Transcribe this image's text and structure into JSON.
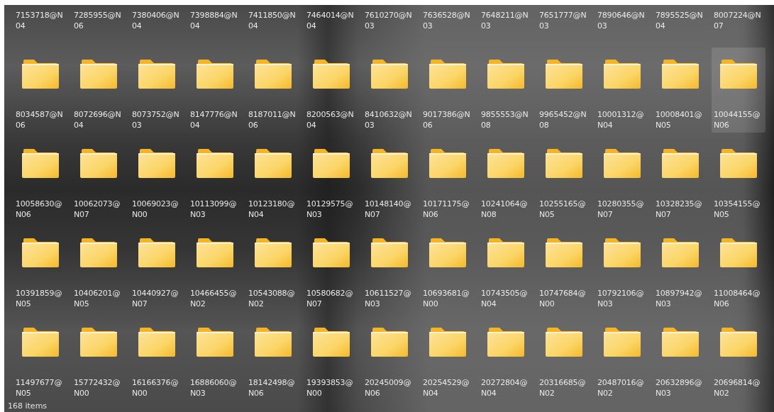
{
  "top_row_labels": [
    "7153718@N04",
    "7285955@N06",
    "7380406@N04",
    "7398884@N04",
    "7411850@N04",
    "7464014@N04",
    "7610270@N03",
    "7636528@N03",
    "7648211@N03",
    "7651777@N03",
    "7890646@N03",
    "7895525@N04",
    "8007224@N07"
  ],
  "items": [
    {
      "name": "8034587@N06",
      "selected": false
    },
    {
      "name": "8072696@N04",
      "selected": false
    },
    {
      "name": "8073752@N03",
      "selected": false
    },
    {
      "name": "8147776@N04",
      "selected": false
    },
    {
      "name": "8187011@N06",
      "selected": false
    },
    {
      "name": "8200563@N04",
      "selected": false
    },
    {
      "name": "8410632@N03",
      "selected": false
    },
    {
      "name": "9017386@N06",
      "selected": false
    },
    {
      "name": "9855553@N08",
      "selected": false
    },
    {
      "name": "9965452@N08",
      "selected": false
    },
    {
      "name": "10001312@N04",
      "selected": false
    },
    {
      "name": "10008401@N05",
      "selected": false
    },
    {
      "name": "10044155@N06",
      "selected": true
    },
    {
      "name": "10058630@N06",
      "selected": false
    },
    {
      "name": "10062073@N07",
      "selected": false
    },
    {
      "name": "10069023@N00",
      "selected": false
    },
    {
      "name": "10113099@N03",
      "selected": false
    },
    {
      "name": "10123180@N04",
      "selected": false
    },
    {
      "name": "10129575@N03",
      "selected": false
    },
    {
      "name": "10148140@N07",
      "selected": false
    },
    {
      "name": "10171175@N06",
      "selected": false
    },
    {
      "name": "10241064@N08",
      "selected": false
    },
    {
      "name": "10255165@N05",
      "selected": false
    },
    {
      "name": "10280355@N07",
      "selected": false
    },
    {
      "name": "10328235@N07",
      "selected": false
    },
    {
      "name": "10354155@N05",
      "selected": false
    },
    {
      "name": "10391859@N05",
      "selected": false
    },
    {
      "name": "10406201@N05",
      "selected": false
    },
    {
      "name": "10440927@N07",
      "selected": false
    },
    {
      "name": "10466455@N02",
      "selected": false
    },
    {
      "name": "10543088@N02",
      "selected": false
    },
    {
      "name": "10580682@N07",
      "selected": false
    },
    {
      "name": "10611527@N03",
      "selected": false
    },
    {
      "name": "10693681@N00",
      "selected": false
    },
    {
      "name": "10743505@N04",
      "selected": false
    },
    {
      "name": "10747684@N00",
      "selected": false
    },
    {
      "name": "10792106@N03",
      "selected": false
    },
    {
      "name": "10897942@N03",
      "selected": false
    },
    {
      "name": "11008464@N06",
      "selected": false
    },
    {
      "name": "11497677@N05",
      "selected": false
    },
    {
      "name": "15772432@N00",
      "selected": false
    },
    {
      "name": "16166376@N00",
      "selected": false
    },
    {
      "name": "16886060@N03",
      "selected": false
    },
    {
      "name": "18142498@N06",
      "selected": false
    },
    {
      "name": "19393853@N00",
      "selected": false
    },
    {
      "name": "20245009@N06",
      "selected": false
    },
    {
      "name": "20254529@N04",
      "selected": false
    },
    {
      "name": "20272804@N04",
      "selected": false
    },
    {
      "name": "20316685@N02",
      "selected": false
    },
    {
      "name": "20487016@N02",
      "selected": false
    },
    {
      "name": "20632896@N03",
      "selected": false
    },
    {
      "name": "20696814@N02",
      "selected": false
    }
  ],
  "status_bar": {
    "item_count": "168 items"
  }
}
